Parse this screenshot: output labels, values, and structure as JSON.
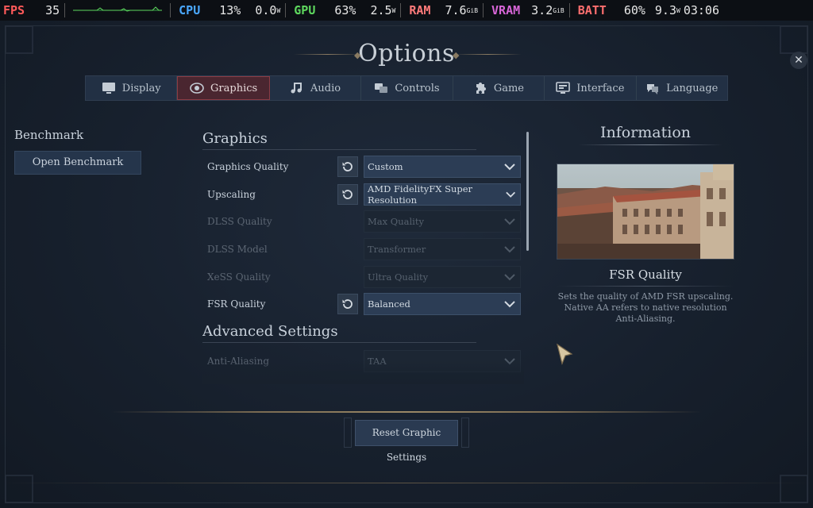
{
  "osd": {
    "fps_label": "FPS",
    "fps_value": "35",
    "cpu_label": "CPU",
    "cpu_usage": "13%",
    "cpu_power": "0.0",
    "cpu_power_unit": "W",
    "gpu_label": "GPU",
    "gpu_usage": "63%",
    "gpu_power": "2.5",
    "gpu_power_unit": "W",
    "ram_label": "RAM",
    "ram_value": "7.6",
    "ram_unit": "GiB",
    "vram_label": "VRAM",
    "vram_value": "3.2",
    "vram_unit": "GiB",
    "batt_label": "BATT",
    "batt_percent": "60%",
    "batt_power": "9.3",
    "batt_power_unit": "W",
    "clock": "03:06"
  },
  "title": "Options",
  "tabs": [
    {
      "label": "Display",
      "icon": "monitor-icon"
    },
    {
      "label": "Graphics",
      "icon": "eye-icon",
      "active": true
    },
    {
      "label": "Audio",
      "icon": "music-note-icon"
    },
    {
      "label": "Controls",
      "icon": "controls-icon"
    },
    {
      "label": "Game",
      "icon": "puzzle-icon"
    },
    {
      "label": "Interface",
      "icon": "interface-icon"
    },
    {
      "label": "Language",
      "icon": "language-icon"
    }
  ],
  "benchmark": {
    "heading": "Benchmark",
    "button": "Open Benchmark"
  },
  "graphics": {
    "section_title": "Graphics",
    "rows": [
      {
        "label": "Graphics Quality",
        "value": "Custom"
      },
      {
        "label": "Upscaling",
        "value": "AMD FidelityFX Super Resolution"
      },
      {
        "label": "DLSS Quality",
        "value": "Max Quality"
      },
      {
        "label": "DLSS Model",
        "value": "Transformer"
      },
      {
        "label": "XeSS Quality",
        "value": "Ultra Quality"
      },
      {
        "label": "FSR Quality",
        "value": "Balanced"
      }
    ],
    "advanced_title": "Advanced Settings",
    "advanced_rows": [
      {
        "label": "Anti-Aliasing",
        "value": "TAA"
      }
    ]
  },
  "info": {
    "heading": "Information",
    "subtitle": "FSR Quality",
    "description": "Sets the quality of AMD FSR upscaling. Native AA refers to native resolution Anti-Aliasing."
  },
  "reset_button": "Reset Graphic Settings",
  "colors": {
    "active_tab": "#4a2630",
    "accent_gold": "#8a7b62"
  }
}
